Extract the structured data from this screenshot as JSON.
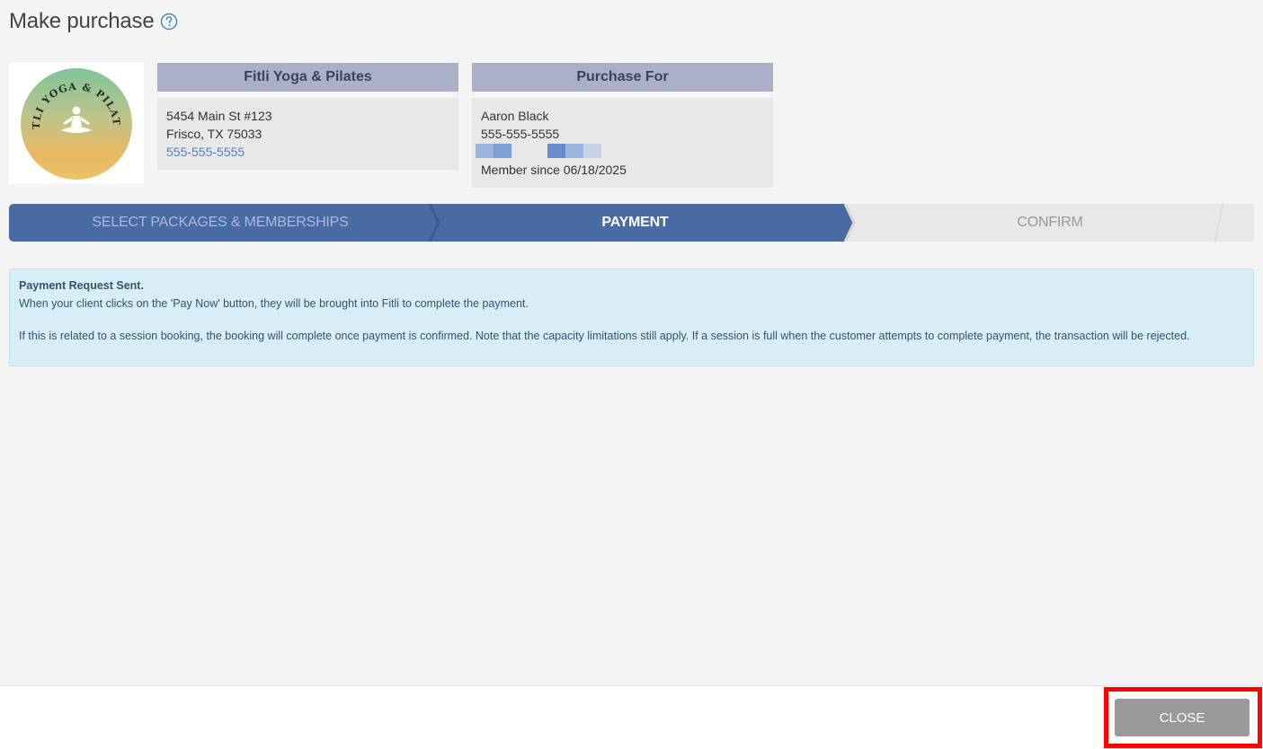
{
  "header": {
    "title": "Make purchase",
    "help_icon": "question-circle-icon"
  },
  "logo": {
    "text_top": "FITLI YOGA & PILATES",
    "icon": "meditation-figure-icon"
  },
  "business": {
    "header": "Fitli Yoga & Pilates",
    "address_line1": "5454 Main St #123",
    "address_line2": "Frisco, TX 75033",
    "phone": "555-555-5555"
  },
  "client": {
    "header": "Purchase For",
    "name": "Aaron Black",
    "phone": "555-555-5555",
    "member_since": "Member since 06/18/2025"
  },
  "steps": [
    {
      "label": "SELECT PACKAGES & MEMBERSHIPS",
      "state": "completed"
    },
    {
      "label": "PAYMENT",
      "state": "active"
    },
    {
      "label": "CONFIRM",
      "state": "pending"
    }
  ],
  "alert": {
    "title": "Payment Request Sent.",
    "line1": "When your client clicks on the 'Pay Now' button, they will be brought into Fitli to complete the payment.",
    "line2": "If this is related to a session booking, the booking will complete once payment is confirmed.  Note that the capacity limitations still apply. If a session is full when the customer attempts  to complete payment, the transaction will be rejected."
  },
  "footer": {
    "close_label": "CLOSE"
  },
  "colors": {
    "step_active": "#4a6aa3",
    "step_pending": "#e8e8e8",
    "card_header": "#a9b0c7",
    "alert_bg": "#d9edf6",
    "highlight": "#ff0000"
  }
}
